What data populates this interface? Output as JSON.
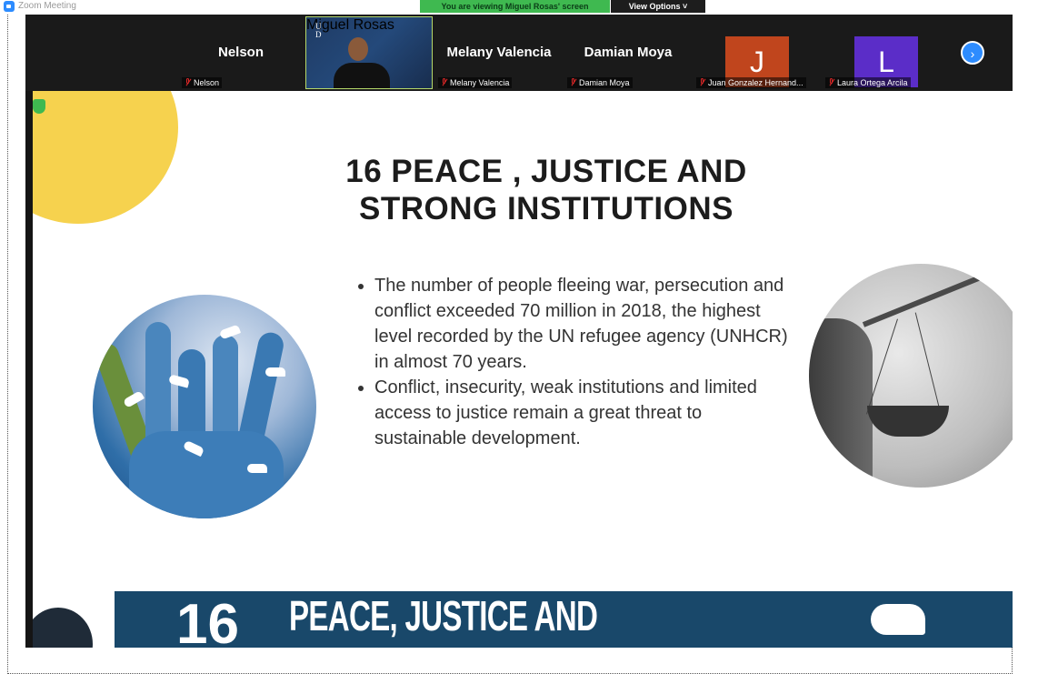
{
  "window": {
    "title": "Zoom Meeting"
  },
  "banner": {
    "viewing_text": "You are viewing Miguel Rosas' screen",
    "view_options": "View Options ˅"
  },
  "participants": [
    {
      "big_name": "Nelson",
      "label": "Nelson",
      "muted": true
    },
    {
      "label": "Miguel Rosas",
      "video": true,
      "logo": "UNIVERSITY OF DELAWARE"
    },
    {
      "big_name": "Melany Valencia",
      "label": "Melany Valencia",
      "muted": true
    },
    {
      "big_name": "Damian Moya",
      "label": "Damian Moya",
      "muted": true
    },
    {
      "initial": "J",
      "label": "Juan Gonzalez Hernand...",
      "muted": true,
      "color": "#c0451d"
    },
    {
      "initial": "L",
      "label": "Laura Ortega Arcila",
      "muted": true,
      "color": "#5b2dc8"
    }
  ],
  "slide": {
    "title_line1": "16 PEACE , JUSTICE AND",
    "title_line2": "STRONG INSTITUTIONS",
    "bullets": [
      "The number of people fleeing war, persecution and conflict exceeded 70 million in 2018, the highest level recorded by the UN refugee agency (UNHCR) in almost 70 years.",
      "Conflict, insecurity, weak institutions and limited access to justice remain a great threat to sustainable development."
    ],
    "footer_number": "16",
    "footer_text": "PEACE, JUSTICE AND"
  },
  "colors": {
    "yellow_circle": "#f6d24e",
    "footer_banner": "#19486a",
    "viewing_banner": "#3fb950",
    "zoom_blue": "#2d8cff"
  }
}
